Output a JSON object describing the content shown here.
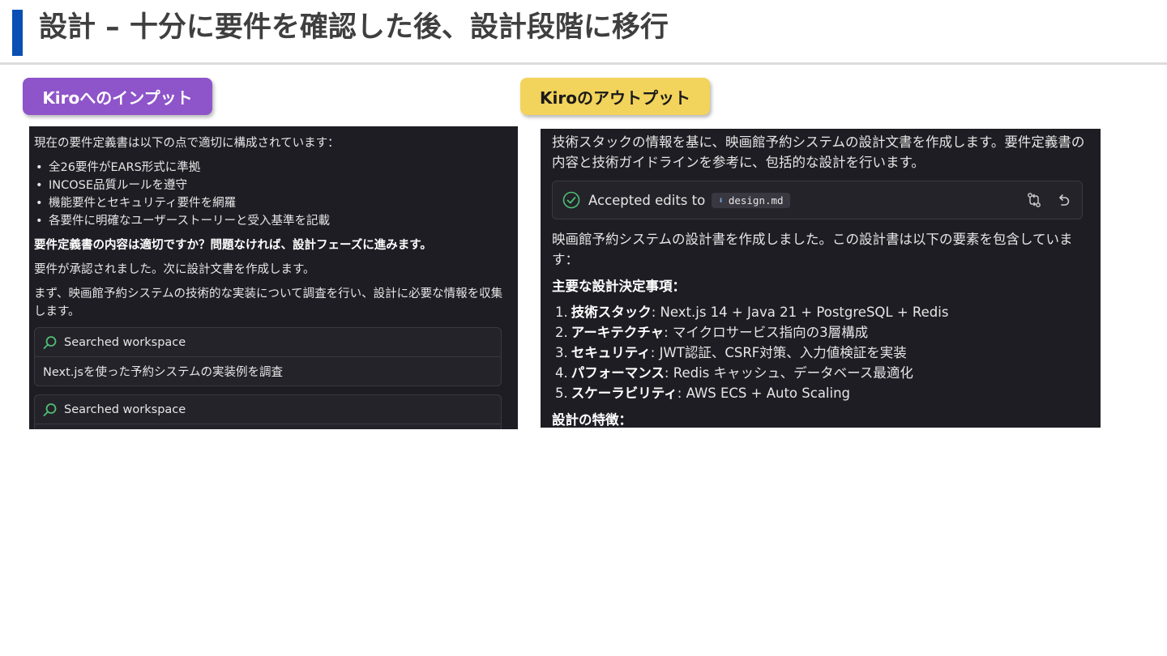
{
  "title": "設計 – 十分に要件を確認した後、設計段階に移行",
  "labels": {
    "input": "Kiroへのインプット",
    "output": "Kiroのアウトプット"
  },
  "left": {
    "intro": "現在の要件定義書は以下の点で適切に構成されています：",
    "bullets": [
      "全26要件がEARS形式に準拠",
      "INCOSE品質ルールを遵守",
      "機能要件とセキュリティ要件を網羅",
      "各要件に明確なユーザーストーリーと受入基準を記載"
    ],
    "question": "要件定義書の内容は適切ですか？問題なければ、設計フェーズに進みます。",
    "approved": "要件が承認されました。次に設計文書を作成します。",
    "research": "まず、映画館予約システムの技術的な実装について調査を行い、設計に必要な情報を収集します。",
    "searches": [
      {
        "header": "Searched workspace",
        "detail": "Next.jsを使った予約システムの実装例を調査"
      },
      {
        "header": "Searched workspace",
        "detail": ""
      }
    ]
  },
  "right": {
    "intro": "技術スタックの情報を基に、映画館予約システムの設計文書を作成します。要件定義書の内容と技術ガイドラインを参考に、包括的な設計を行います。",
    "accepted": {
      "text": "Accepted edits to",
      "file": "design.md"
    },
    "summary": "映画館予約システムの設計書を作成しました。この設計書は以下の要素を包含しています：",
    "decisions_heading": "主要な設計決定事項：",
    "decisions": [
      {
        "num": "1.",
        "term": "技術スタック",
        "desc": ": Next.js 14 + Java 21 + PostgreSQL + Redis"
      },
      {
        "num": "2.",
        "term": "アーキテクチャ",
        "desc": ": マイクロサービス指向の3層構成"
      },
      {
        "num": "3.",
        "term": "セキュリティ",
        "desc": ": JWT認証、CSRF対策、入力値検証を実装"
      },
      {
        "num": "4.",
        "term": "パフォーマンス",
        "desc": ": Redis キャッシュ、データベース最適化"
      },
      {
        "num": "5.",
        "term": "スケーラビリティ",
        "desc": ": AWS ECS + Auto Scaling"
      }
    ],
    "features_heading": "設計の特徴："
  },
  "icons": {
    "search": "search-icon",
    "check": "check-circle-icon",
    "compare": "compare-icon",
    "undo": "undo-icon",
    "download": "download-icon"
  },
  "colors": {
    "accent": "#0a4fb4",
    "input_pill": "#8e54c9",
    "output_pill": "#f2d35b",
    "panel_bg": "#1f1d24",
    "success": "#4fbf73"
  }
}
